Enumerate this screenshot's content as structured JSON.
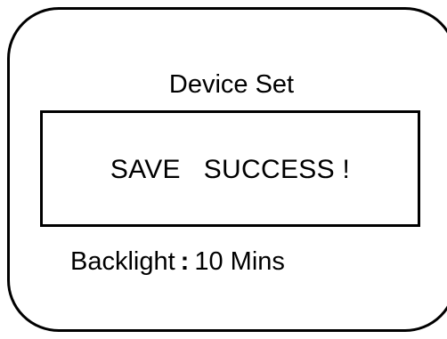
{
  "screen": {
    "title": "Device Set"
  },
  "dialog": {
    "message": "SAVE   SUCCESS !"
  },
  "setting": {
    "label": "Backlight",
    "separator": ":",
    "value": "10 Mins"
  }
}
